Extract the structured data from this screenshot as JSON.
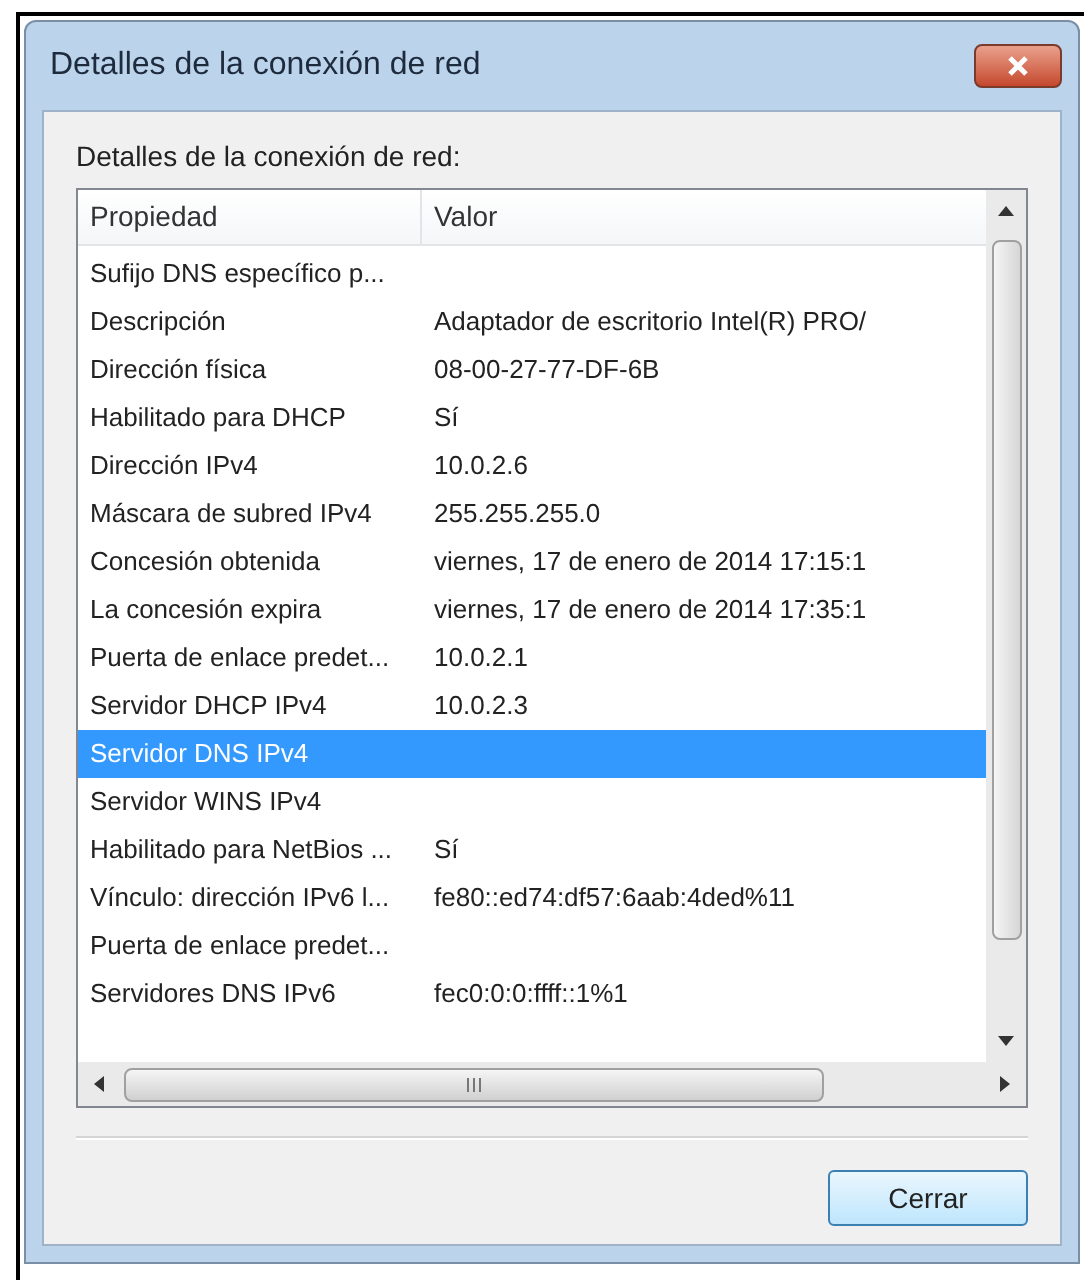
{
  "window": {
    "title": "Detalles de la conexión de red"
  },
  "label": "Detalles de la conexión de red:",
  "table": {
    "columns": [
      "Propiedad",
      "Valor"
    ],
    "rows": [
      {
        "property": "Sufijo DNS específico p...",
        "value": "",
        "selected": false
      },
      {
        "property": "Descripción",
        "value": "Adaptador de escritorio Intel(R) PRO/",
        "selected": false
      },
      {
        "property": "Dirección física",
        "value": "08-00-27-77-DF-6B",
        "selected": false
      },
      {
        "property": "Habilitado para DHCP",
        "value": "Sí",
        "selected": false
      },
      {
        "property": "Dirección IPv4",
        "value": "10.0.2.6",
        "selected": false
      },
      {
        "property": "Máscara de subred IPv4",
        "value": "255.255.255.0",
        "selected": false
      },
      {
        "property": "Concesión obtenida",
        "value": "viernes, 17 de enero de 2014 17:15:1",
        "selected": false
      },
      {
        "property": "La concesión expira",
        "value": "viernes, 17 de enero de 2014 17:35:1",
        "selected": false
      },
      {
        "property": "Puerta de enlace predet...",
        "value": "10.0.2.1",
        "selected": false
      },
      {
        "property": "Servidor DHCP IPv4",
        "value": "10.0.2.3",
        "selected": false
      },
      {
        "property": "Servidor DNS IPv4",
        "value": "",
        "selected": true
      },
      {
        "property": "Servidor WINS IPv4",
        "value": "",
        "selected": false
      },
      {
        "property": "Habilitado para NetBios ...",
        "value": "Sí",
        "selected": false
      },
      {
        "property": "Vínculo: dirección IPv6 l...",
        "value": "fe80::ed74:df57:6aab:4ded%11",
        "selected": false
      },
      {
        "property": "Puerta de enlace predet...",
        "value": "",
        "selected": false
      },
      {
        "property": "Servidores DNS IPv6",
        "value": "fec0:0:0:ffff::1%1",
        "selected": false
      }
    ]
  },
  "buttons": [
    {
      "label": "Cerrar"
    }
  ]
}
